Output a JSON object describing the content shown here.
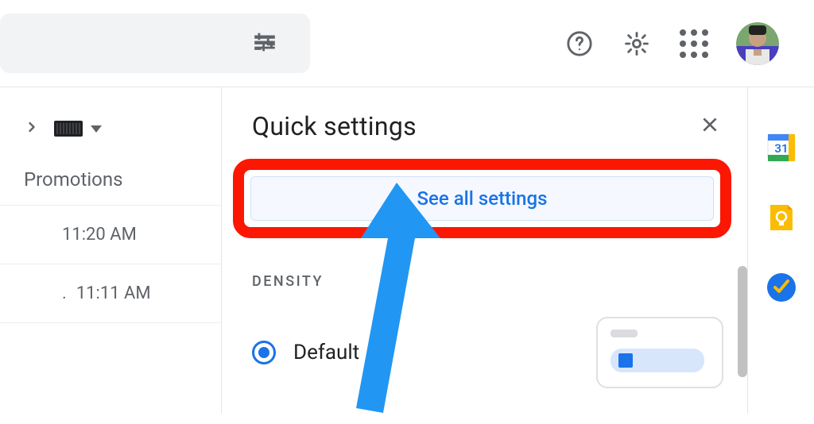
{
  "header": {
    "icons": {
      "help": "help-icon",
      "settings": "gear-icon",
      "apps": "apps-grid-icon"
    }
  },
  "left": {
    "tab_label": "Promotions",
    "rows": [
      {
        "time": "11:20 AM"
      },
      {
        "time": "11:11 AM"
      }
    ]
  },
  "panel": {
    "title": "Quick settings",
    "see_all": "See all settings",
    "density_label": "DENSITY",
    "density_option": "Default"
  },
  "rail": {
    "calendar_day": "31"
  },
  "colors": {
    "accent": "#1a73e8",
    "annotation_red": "#fc1703",
    "annotation_blue": "#2196f3"
  }
}
